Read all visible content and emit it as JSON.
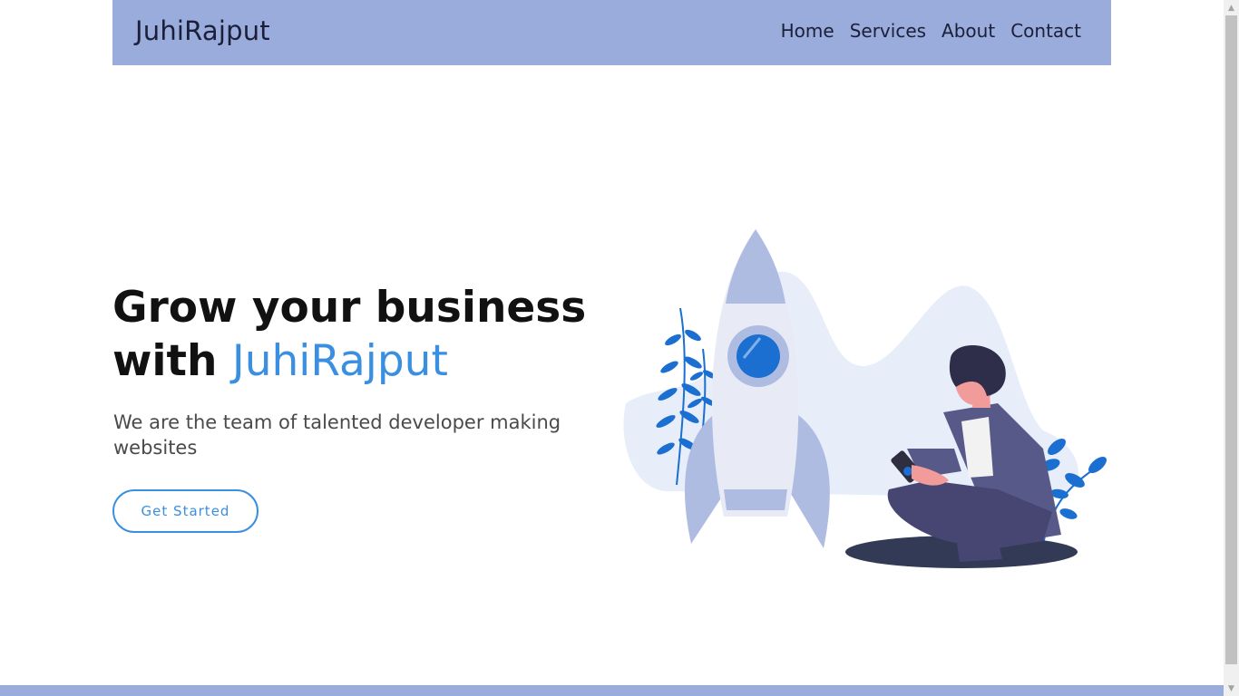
{
  "header": {
    "brand": "JuhiRajput",
    "nav": [
      "Home",
      "Services",
      "About",
      "Contact"
    ]
  },
  "hero": {
    "title_line1": "Grow your business",
    "title_line2_prefix": "with",
    "title_accent": "JuhiRajput",
    "subtitle": "We are the team of talented developer making websites",
    "cta_label": "Get Started"
  },
  "colors": {
    "navbar_bg": "#99acdb",
    "accent": "#3a8fe0",
    "text_dark": "#111111"
  },
  "icons": {
    "scroll_up": "▲",
    "scroll_down": "▼"
  }
}
